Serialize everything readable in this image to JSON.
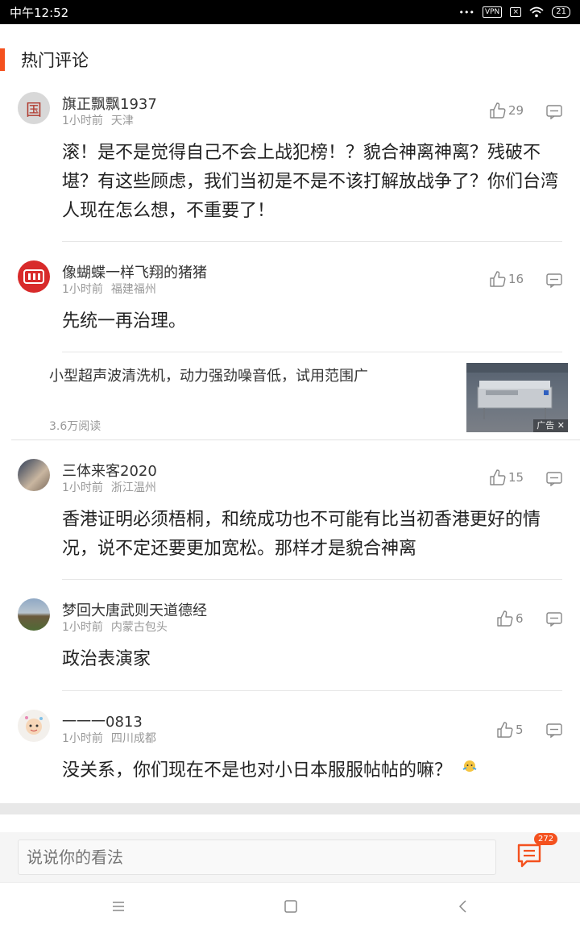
{
  "status_bar": {
    "time": "中午12:52",
    "vpn": "VPN",
    "battery": "21"
  },
  "section": {
    "title": "热门评论"
  },
  "comments": [
    {
      "user": "旗正飘飘1937",
      "time": "1小时前",
      "location": "天津",
      "likes": "29",
      "text": "滚！是不是觉得自己不会上战犯榜！？貌合神离神离？残破不堪？有这些顾虑，我们当初是不是不该打解放战争了？你们台湾人现在怎么想，不重要了！",
      "avatar_char": "国"
    },
    {
      "user": "像蝴蝶一样飞翔的猪猪",
      "time": "1小时前",
      "location": "福建福州",
      "likes": "16",
      "text": "先统一再治理。"
    },
    {
      "user": "三体来客2020",
      "time": "1小时前",
      "location": "浙江温州",
      "likes": "15",
      "text": "香港证明必须梧桐，和统成功也不可能有比当初香港更好的情况，说不定还要更加宽松。那样才是貌合神离"
    },
    {
      "user": "梦回大唐武则天道德经",
      "time": "1小时前",
      "location": "内蒙古包头",
      "likes": "6",
      "text": "政治表演家"
    },
    {
      "user": "一一一0813",
      "time": "1小时前",
      "location": "四川成都",
      "likes": "5",
      "text": "没关系，你们现在不是也对小日本服服帖帖的嘛？"
    }
  ],
  "ad": {
    "title": "小型超声波清洗机，动力强劲噪音低，试用范围广",
    "reads": "3.6万阅读",
    "tag": "广告"
  },
  "input": {
    "placeholder": "说说你的看法"
  },
  "comment_count": "272",
  "colors": {
    "accent": "#f4511e"
  }
}
